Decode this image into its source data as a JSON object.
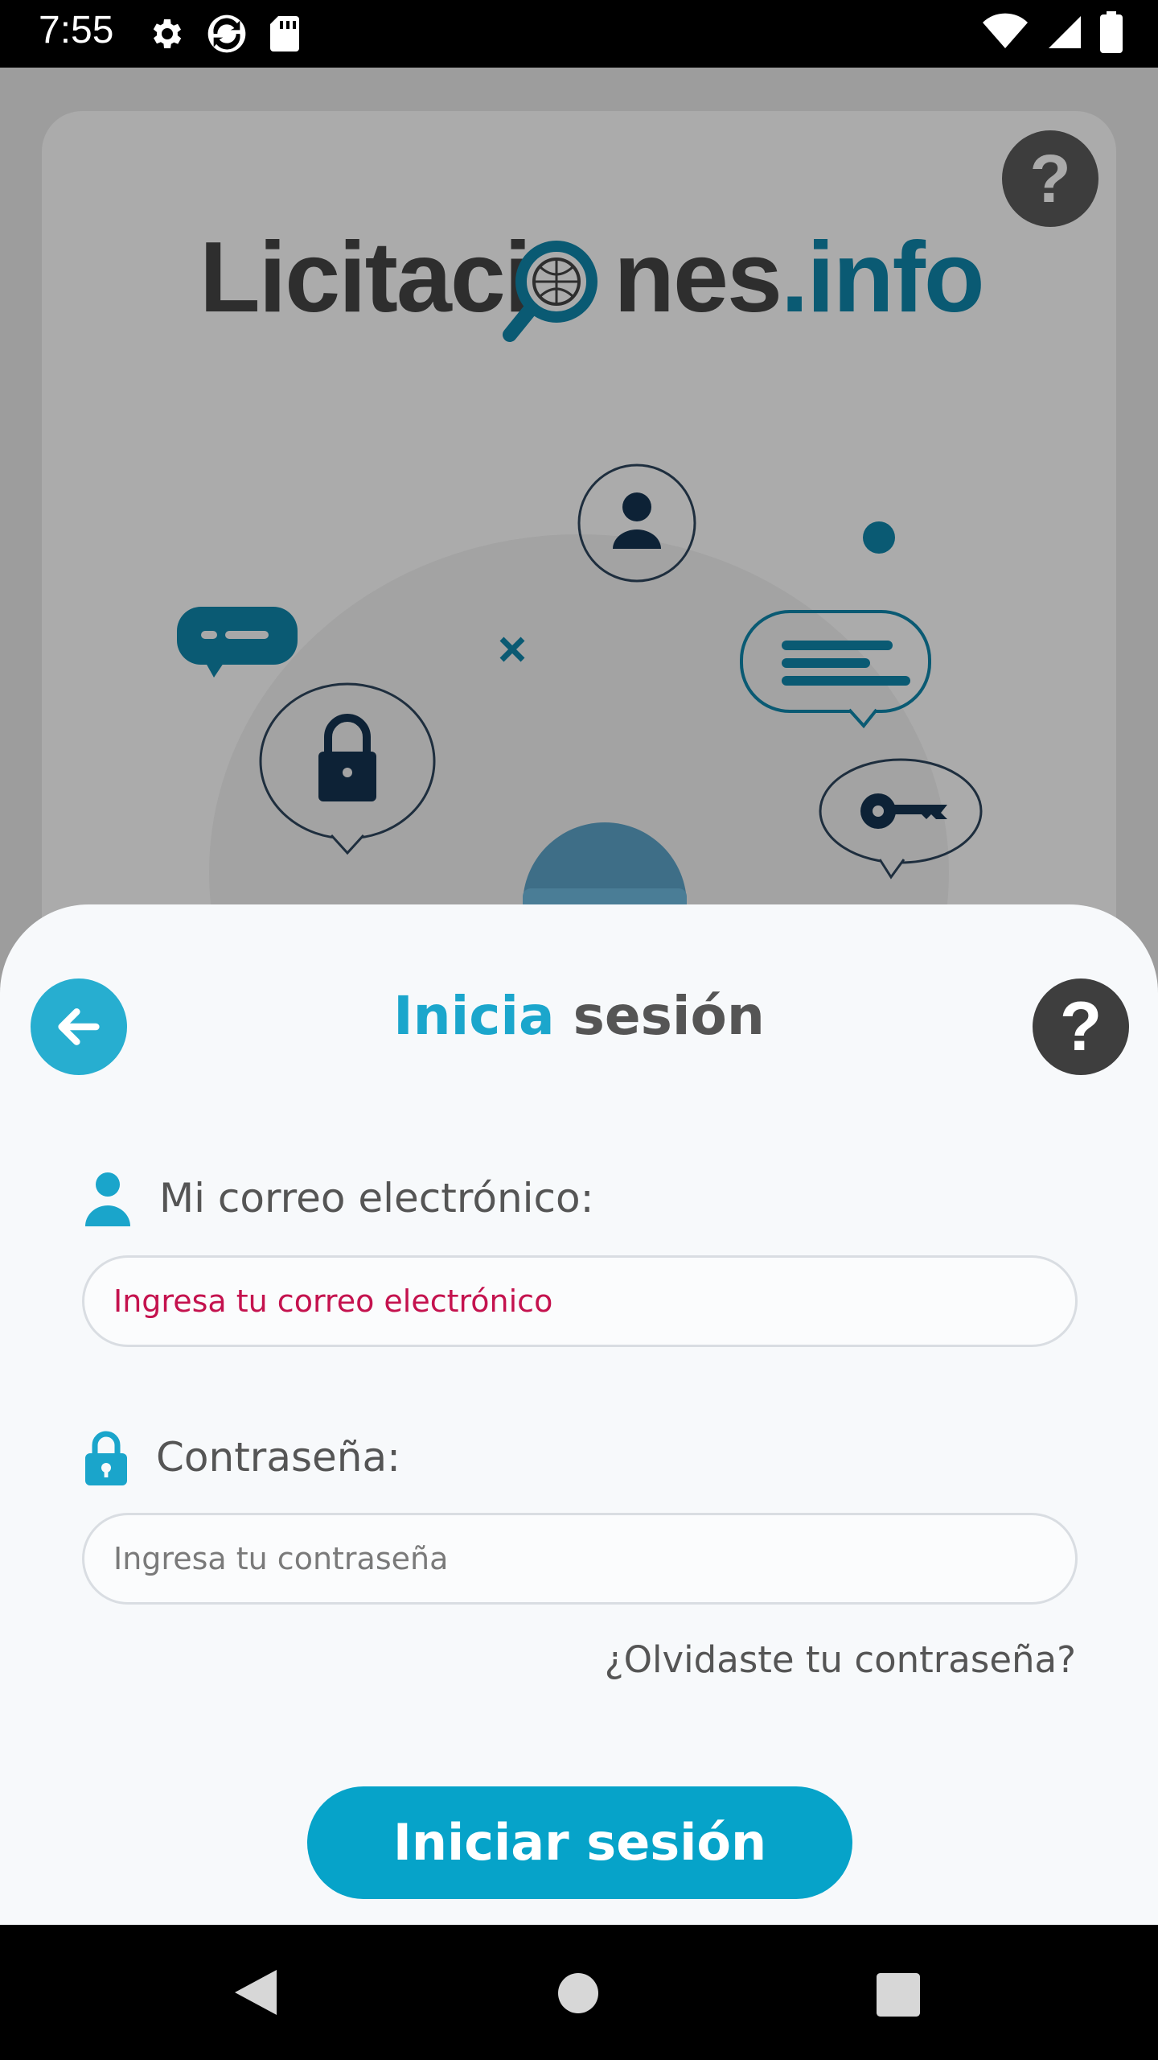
{
  "status_bar": {
    "time": "7:55",
    "icons_left": [
      "gear-icon",
      "sync-icon",
      "sd-card-icon"
    ],
    "icons_right": [
      "wifi-icon",
      "cell-signal-icon",
      "battery-icon"
    ]
  },
  "background": {
    "logo": {
      "part1": "Licitaci",
      "part2": "nes",
      "part3": ".info"
    },
    "help_glyph": "?",
    "colors": {
      "overlay": "#9d9d9d",
      "logo_blue": "#0a5a73"
    }
  },
  "sheet": {
    "title_accent": "Inicia",
    "title_rest": "sesión",
    "help_glyph": "?",
    "email": {
      "label": "Mi correo electrónico:",
      "placeholder": "Ingresa tu correo electrónico"
    },
    "password": {
      "label": "Contraseña:",
      "placeholder": "Ingresa tu contraseña"
    },
    "forgot_password": "¿Olvidaste tu contraseña?",
    "login_button": "Iniciar sesión",
    "colors": {
      "accent": "#1ba6cc",
      "button": "#06a3c9",
      "error_placeholder": "#c4124e",
      "help": "#3e3e3e"
    }
  },
  "nav_bar": {
    "buttons": [
      "back-icon",
      "home-icon",
      "recents-icon"
    ]
  }
}
